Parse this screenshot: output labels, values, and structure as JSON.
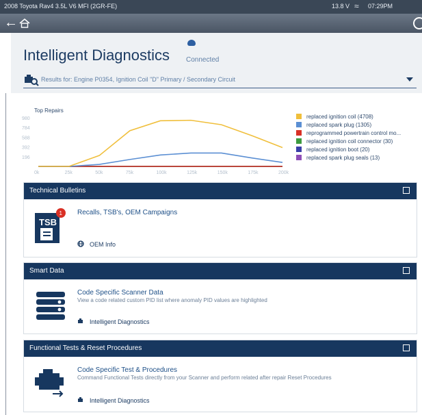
{
  "status_bar": {
    "vehicle": "2008 Toyota Rav4 3.5L V6 MFI (2GR-FE)",
    "voltage": "13.8 V",
    "time": "07:29PM"
  },
  "header": {
    "title": "Intelligent Diagnostics",
    "connection_status": "Connected",
    "results_for": "Results for:  Engine P0354, Ignition Coil \"D\" Primary / Secondary Circuit"
  },
  "chart_data": {
    "type": "line",
    "title": "Top Repairs",
    "x": [
      "0k",
      "25k",
      "50k",
      "75k",
      "100k",
      "125k",
      "150k",
      "175k",
      "200k"
    ],
    "ytick_labels": [
      "980",
      "784",
      "588",
      "392",
      "196"
    ],
    "ylim": [
      0,
      980
    ],
    "series": [
      {
        "name": "replaced ignition coil (4708)",
        "color": "#f0bf3c",
        "values": [
          0,
          0,
          220,
          720,
          920,
          930,
          840,
          620,
          380
        ]
      },
      {
        "name": "replaced spark plug (1305)",
        "color": "#5b8fd3",
        "values": [
          0,
          0,
          40,
          140,
          230,
          270,
          270,
          170,
          80
        ]
      },
      {
        "name": "reprogrammed powertrain control mo...",
        "color": "#d93025",
        "values": [
          0,
          0,
          0,
          0,
          0,
          0,
          0,
          0,
          0
        ]
      },
      {
        "name": "replaced ignition coil connector (30)",
        "color": "#3c9b3f",
        "values": [
          0,
          0,
          0,
          0,
          0,
          0,
          0,
          0,
          0
        ]
      },
      {
        "name": "replaced ignition boot (20)",
        "color": "#3a3fa8",
        "values": [
          0,
          0,
          0,
          0,
          0,
          0,
          0,
          0,
          0
        ]
      },
      {
        "name": "replaced spark plug seals (13)",
        "color": "#8e4fb8",
        "values": [
          0,
          0,
          0,
          0,
          0,
          0,
          0,
          0,
          0
        ]
      }
    ]
  },
  "cards": [
    {
      "title": "Technical Bulletins",
      "heading": "Recalls, TSB's, OEM Campaigns",
      "description": "",
      "link": "OEM Info",
      "badge": "1",
      "icon_text": "TSB"
    },
    {
      "title": "Smart Data",
      "heading": "Code Specific Scanner Data",
      "description": "View a code related custom PID list where anomaly PID values are highlighted",
      "link": "Intelligent Diagnostics"
    },
    {
      "title": "Functional Tests & Reset Procedures",
      "heading": "Code Specific Test & Procedures",
      "description": "Command Functional Tests directly from your Scanner and perform related after repair Reset Procedures",
      "link": "Intelligent Diagnostics"
    }
  ]
}
